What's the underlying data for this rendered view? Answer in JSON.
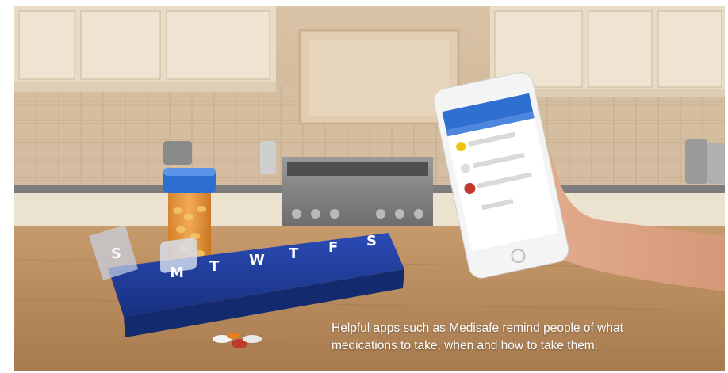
{
  "caption": {
    "line1": "Helpful apps such as Medisafe remind people of what",
    "line2": "medications to take, when and how to take them."
  },
  "pill_organizer": {
    "day_letters": [
      "M",
      "T",
      "W",
      "T",
      "F",
      "S"
    ],
    "open_lid_letter": "S"
  },
  "colors": {
    "counter_top": "#b98c5e",
    "organizer_blue": "#1f3a9c",
    "pill_bottle": "#e8963a",
    "bottle_cap": "#2d6ed1",
    "app_header": "#2f6fd0"
  }
}
